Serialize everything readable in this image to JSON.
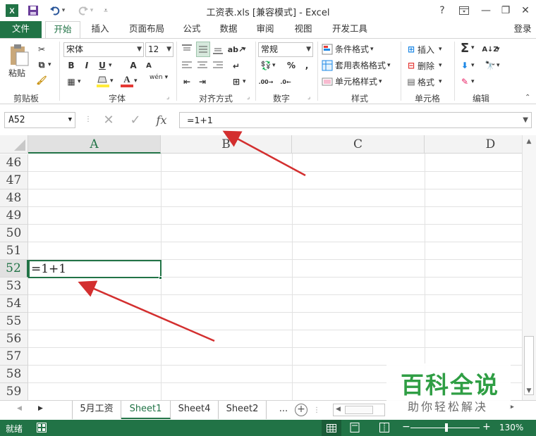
{
  "window": {
    "title": "工资表.xls  [兼容模式] - Excel",
    "help": "?",
    "restore": "❐",
    "minimize": "—",
    "close": "✕"
  },
  "quick_access": {
    "app_icon": "X",
    "save": "💾",
    "undo": "↶",
    "redo": "↷",
    "customize": "▾"
  },
  "tabs": [
    "文件",
    "开始",
    "插入",
    "页面布局",
    "公式",
    "数据",
    "审阅",
    "视图",
    "开发工具"
  ],
  "login": "登录",
  "ribbon": {
    "clipboard": {
      "paste": "粘贴",
      "label": "剪贴板"
    },
    "font": {
      "family": "宋体",
      "size": "12",
      "bold": "B",
      "italic": "I",
      "underline": "U",
      "grow": "A",
      "shrink": "A",
      "wen": "wén",
      "label": "字体"
    },
    "alignment": {
      "label": "对齐方式"
    },
    "number": {
      "format": "常规",
      "percent": "%",
      "comma": ",",
      "label": "数字"
    },
    "styles": {
      "conditional": "条件格式",
      "table": "套用表格格式",
      "cell": "单元格样式",
      "label": "样式"
    },
    "cells": {
      "insert": "插入",
      "delete": "删除",
      "format": "格式",
      "label": "单元格"
    },
    "editing": {
      "sum": "Σ",
      "label": "编辑"
    }
  },
  "formula_bar": {
    "name_box": "A52",
    "fx": "fx",
    "formula": "=1+1"
  },
  "grid": {
    "columns": [
      "A",
      "B",
      "C",
      "D"
    ],
    "rows": [
      "46",
      "47",
      "48",
      "49",
      "50",
      "51",
      "52",
      "53",
      "54",
      "55",
      "56",
      "57",
      "58",
      "59"
    ],
    "active_cell": {
      "ref": "A52",
      "value": "=1+1"
    }
  },
  "sheets": [
    "5月工资",
    "Sheet1",
    "Sheet4",
    "Sheet2"
  ],
  "sheet_more": "...",
  "active_sheet": "Sheet1",
  "status": {
    "ready": "就绪",
    "zoom": "130%"
  },
  "watermark": {
    "title": "百科全说",
    "subtitle": "助你轻松解决"
  },
  "colors": {
    "excel_green": "#217346",
    "arrow_red": "#d32f2f",
    "watermark_green": "#2f9e44"
  }
}
